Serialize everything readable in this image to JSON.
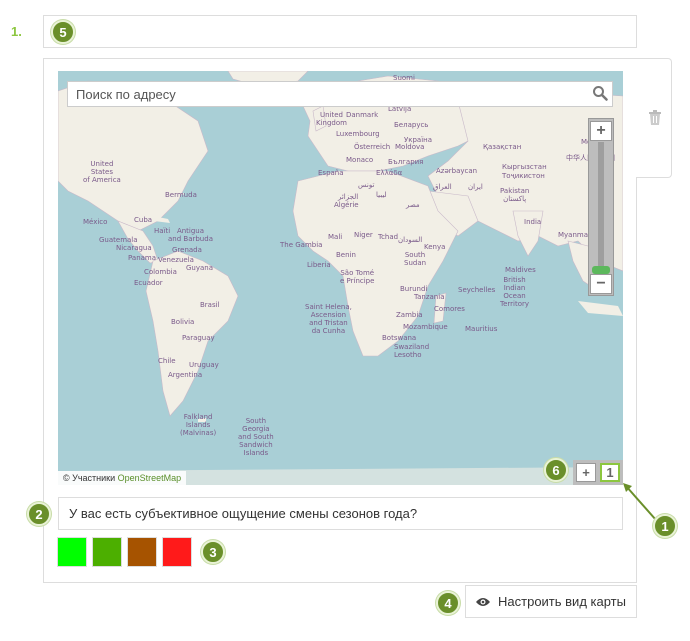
{
  "question": {
    "number": "1.",
    "title_placeholder": "",
    "text": "У вас есть субъективное ощущение смены сезонов года?"
  },
  "map": {
    "search_placeholder": "Поиск по адресу",
    "attribution_prefix": "© Участники ",
    "attribution_link": "OpenStreetMap",
    "zoom_in": "+",
    "zoom_out": "−",
    "layer_add": "+",
    "layer_current": "1",
    "labels": [
      {
        "text": "Suomi"
      },
      {
        "text": "Latvija"
      },
      {
        "text": "Danmark"
      },
      {
        "text": "United\nKingdom"
      },
      {
        "text": "Беларусь"
      },
      {
        "text": "Luxembourg"
      },
      {
        "text": "Україна"
      },
      {
        "text": "Österreich"
      },
      {
        "text": "Moldova"
      },
      {
        "text": "Қазақстан"
      },
      {
        "text": "Monaco"
      },
      {
        "text": "България"
      },
      {
        "text": "Кыргызстан"
      },
      {
        "text": "España"
      },
      {
        "text": "Ελλάδα"
      },
      {
        "text": "Azərbaycan"
      },
      {
        "text": "Тоҷикистон"
      },
      {
        "text": "United\nStates\nof America"
      },
      {
        "text": "تونس"
      },
      {
        "text": "العراق"
      },
      {
        "text": "ایران"
      },
      {
        "text": "Pakistan\nپاکستان"
      },
      {
        "text": "Bermuda"
      },
      {
        "text": "Algérie"
      },
      {
        "text": "الجزائر"
      },
      {
        "text": "ليبيا"
      },
      {
        "text": "مصر"
      },
      {
        "text": "México"
      },
      {
        "text": "Cuba"
      },
      {
        "text": "Haïti"
      },
      {
        "text": "Antigua\nand Barbuda"
      },
      {
        "text": "India"
      },
      {
        "text": "Myanmar"
      },
      {
        "text": "Guatemala"
      },
      {
        "text": "Nicaragua"
      },
      {
        "text": "Grenada"
      },
      {
        "text": "Mali"
      },
      {
        "text": "Niger"
      },
      {
        "text": "Tchad"
      },
      {
        "text": "السودان"
      },
      {
        "text": "Panama"
      },
      {
        "text": "Venezuela"
      },
      {
        "text": "The Gambia"
      },
      {
        "text": "Benin"
      },
      {
        "text": "Colombia"
      },
      {
        "text": "Guyana"
      },
      {
        "text": "Liberia"
      },
      {
        "text": "South\nSudan"
      },
      {
        "text": "Ecuador"
      },
      {
        "text": "São Tomé\ne Príncipe"
      },
      {
        "text": "Kenya"
      },
      {
        "text": "Maldives"
      },
      {
        "text": "Burundi"
      },
      {
        "text": "Tanzania"
      },
      {
        "text": "Seychelles"
      },
      {
        "text": "Brasil"
      },
      {
        "text": "British\nIndian\nOcean\nTerritory"
      },
      {
        "text": "Saint Helena,\nAscension\nand Tristan\nda Cunha"
      },
      {
        "text": "Zambia"
      },
      {
        "text": "Comores"
      },
      {
        "text": "Bolivia"
      },
      {
        "text": "Mozambique"
      },
      {
        "text": "Mauritius"
      },
      {
        "text": "Paraguay"
      },
      {
        "text": "Botswana"
      },
      {
        "text": "Swaziland"
      },
      {
        "text": "Lesotho"
      },
      {
        "text": "Chile"
      },
      {
        "text": "Uruguay"
      },
      {
        "text": "Argentina"
      },
      {
        "text": "Falkland\nIslands\n(Malvinas)"
      },
      {
        "text": "South\nGeorgia\nand South\nSandwich\nIslands"
      },
      {
        "text": "Mongolia"
      },
      {
        "text": "中华人民共和国"
      }
    ]
  },
  "colors": {
    "swatches": [
      "#00ff00",
      "#4caf00",
      "#a65300",
      "#ff1a1a"
    ],
    "accent": "#8cc63f",
    "badge": "#6a8f2a"
  },
  "badges": [
    "5",
    "2",
    "3",
    "4",
    "6",
    "1"
  ],
  "settings_button": {
    "label": "Настроить вид карты"
  }
}
